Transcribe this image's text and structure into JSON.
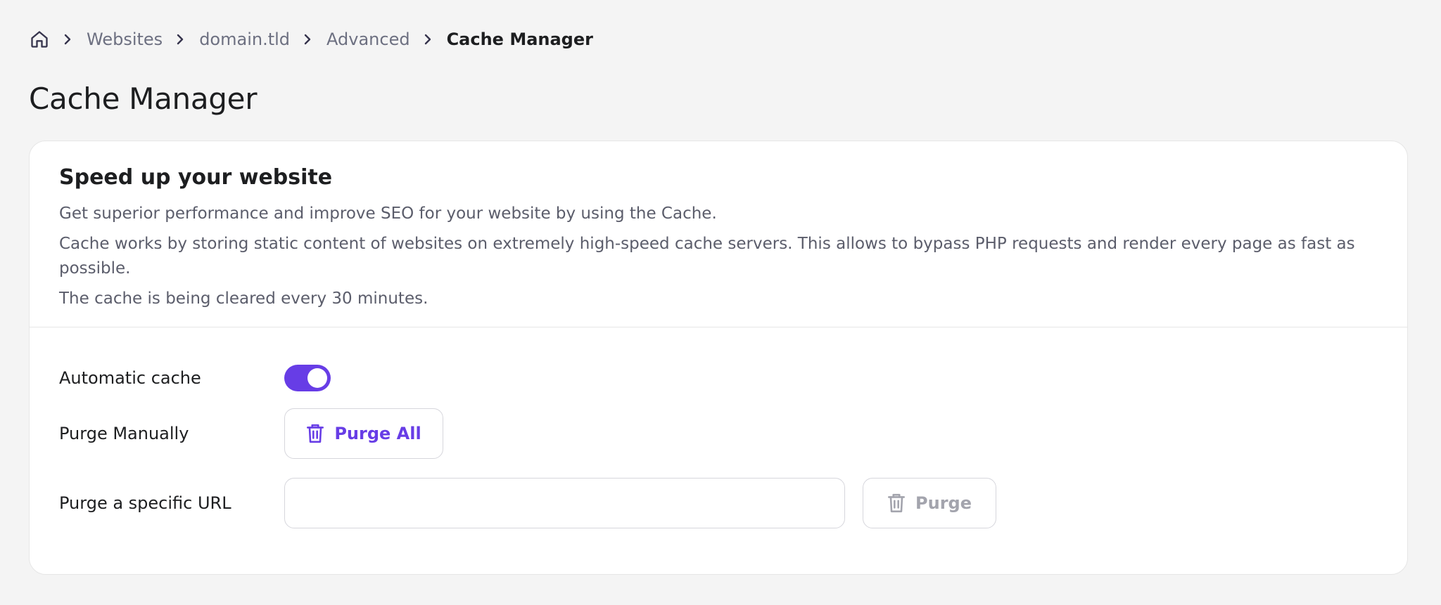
{
  "breadcrumb": {
    "items": [
      "Websites",
      "domain.tld",
      "Advanced"
    ],
    "current": "Cache Manager"
  },
  "page": {
    "title": "Cache Manager"
  },
  "card": {
    "title": "Speed up your website",
    "desc1": "Get superior performance and improve SEO for your website by using the Cache.",
    "desc2": "Cache works by storing static content of websites on extremely high-speed cache servers. This allows to bypass PHP requests and render every page as fast as possible.",
    "desc3": "The cache is being cleared every 30 minutes."
  },
  "settings": {
    "auto_cache": {
      "label": "Automatic cache",
      "enabled": true
    },
    "purge_manual": {
      "label": "Purge Manually",
      "button": "Purge All"
    },
    "purge_url": {
      "label": "Purge a specific URL",
      "value": "",
      "placeholder": "",
      "button": "Purge"
    }
  },
  "icons": {
    "home": "home-icon",
    "separator": "chevron-right-icon",
    "trash": "trash-icon"
  },
  "colors": {
    "accent": "#673de6",
    "background": "#f4f4f4",
    "muted_text": "#6d7081",
    "disabled_text": "#a3a4ad"
  }
}
